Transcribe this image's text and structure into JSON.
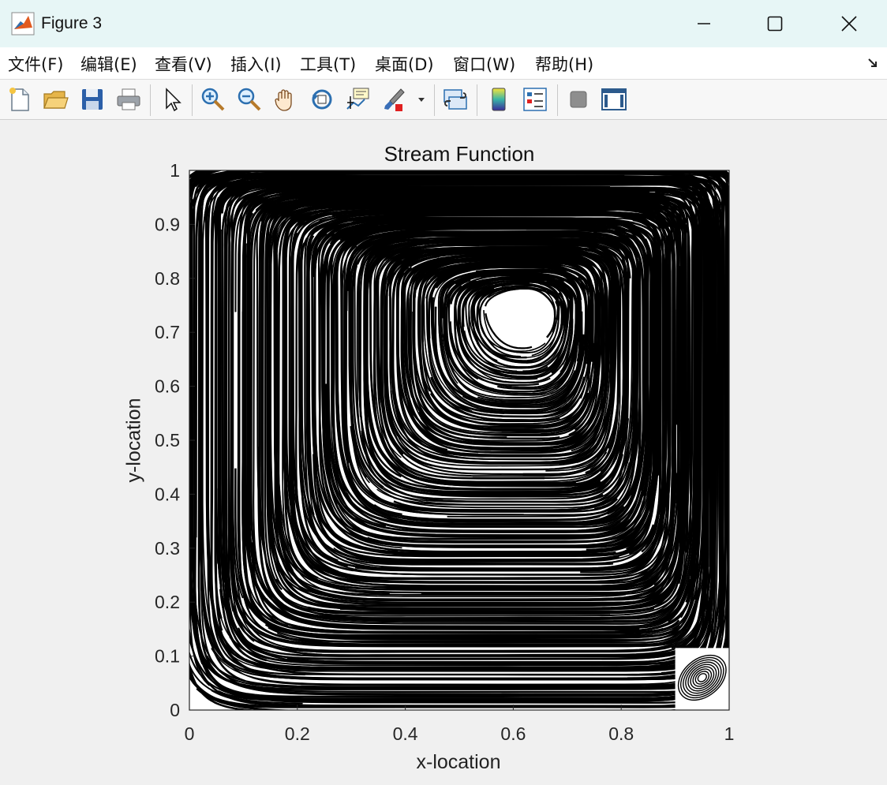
{
  "window": {
    "title": "Figure 3",
    "buttons": [
      "minimize",
      "maximize",
      "close"
    ]
  },
  "menubar": {
    "items": [
      "文件(F)",
      "编辑(E)",
      "查看(V)",
      "插入(I)",
      "工具(T)",
      "桌面(D)",
      "窗口(W)",
      "帮助(H)"
    ]
  },
  "toolbar": {
    "buttons": [
      "new-figure-icon",
      "open-file-icon",
      "save-icon",
      "print-icon",
      "edit-plot-arrow-icon",
      "zoom-in-icon",
      "zoom-out-icon",
      "pan-hand-icon",
      "rotate-3d-icon",
      "data-cursor-icon",
      "brush-icon",
      "brush-dropdown-icon",
      "link-plot-icon",
      "colorbar-icon",
      "legend-icon",
      "hide-plot-tools-icon",
      "show-plot-tools-icon"
    ]
  },
  "chart_data": {
    "type": "streamline",
    "title": "Stream Function",
    "xlabel": "x-location",
    "ylabel": "y-location",
    "xlim": [
      0,
      1
    ],
    "ylim": [
      0,
      1
    ],
    "xticks": [
      "0",
      "0.2",
      "0.4",
      "0.6",
      "0.8",
      "1"
    ],
    "yticks": [
      "0",
      "0.1",
      "0.2",
      "0.3",
      "0.4",
      "0.5",
      "0.6",
      "0.7",
      "0.8",
      "0.9",
      "1"
    ],
    "line_color": "#000000",
    "primary_vortex_center": [
      0.62,
      0.74
    ],
    "secondary_vortex_center": [
      0.95,
      0.06
    ],
    "grid": false
  }
}
